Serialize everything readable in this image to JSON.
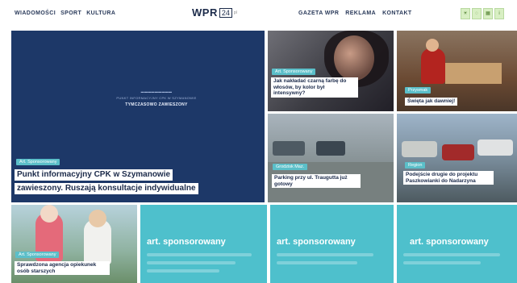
{
  "header": {
    "nav_left": [
      "WIADOMOŚCI",
      "SPORT",
      "KULTURA"
    ],
    "nav_right": [
      "GAZETA WPR",
      "REKLAMA",
      "KONTAKT"
    ],
    "logo": {
      "text": "WPR",
      "box": "24",
      "sub": "pl"
    }
  },
  "hero": {
    "badge": "Art. Sponsorowany",
    "title_line1": "Punkt informacyjny CPK w Szymanowie",
    "title_line2": "zawieszony. Ruszają konsultacje indywidualne",
    "inner_heading": "PUNKT INFORMACYJNY CPK W SZYMANOWIE",
    "inner_strong": "TYMCZASOWO ZAWIESZONY"
  },
  "tiles": {
    "woman": {
      "badge": "Art. Sponsorowany",
      "caption": "Jak nakładać czarną farbę do włosów, by kolor był intensywny?"
    },
    "market": {
      "badge": "Przysmak",
      "caption": "Święta jak dawniej!"
    },
    "street": {
      "badge": "Grodzisk Maz.",
      "caption": "Parking przy ul. Traugutta już gotowy"
    },
    "traffic": {
      "badge": "Region",
      "caption": "Podejście drugie do projektu Paszkowianki do Nadarzyna"
    },
    "elder": {
      "badge": "Art. Sponsorowany",
      "caption": "Sprawdzona agencja opiekunek osób starszych"
    }
  },
  "sponsored": [
    "art. sponsorowany",
    "art. sponsorowany",
    "art. sponsorowany"
  ],
  "colors": {
    "navy": "#1d3868",
    "teal": "#4ec0cc",
    "badge": "#5bbfc9",
    "text": "#1b2a4a"
  }
}
